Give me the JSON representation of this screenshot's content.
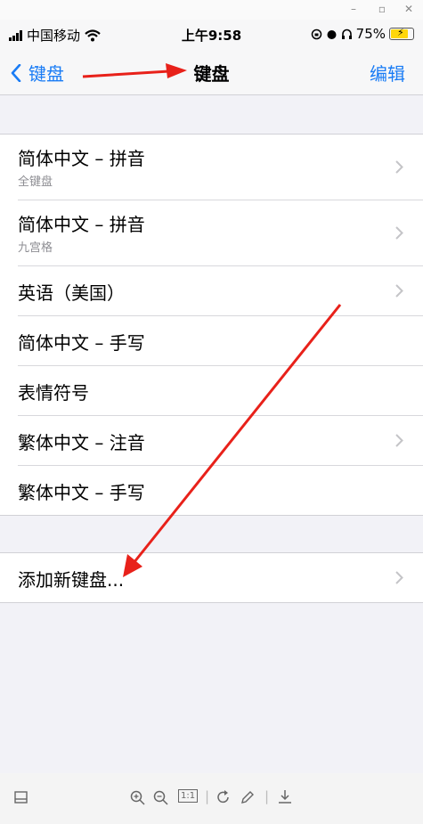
{
  "status_bar": {
    "carrier": "中国移动",
    "time": "上午9:58",
    "battery": "75%"
  },
  "nav": {
    "back_label": "键盘",
    "title": "键盘",
    "edit_label": "编辑"
  },
  "keyboards": [
    {
      "title": "简体中文 – 拼音",
      "subtitle": "全键盘",
      "chevron": true
    },
    {
      "title": "简体中文 – 拼音",
      "subtitle": "九宫格",
      "chevron": true
    },
    {
      "title": "英语（美国）",
      "subtitle": "",
      "chevron": true
    },
    {
      "title": "简体中文 – 手写",
      "subtitle": "",
      "chevron": false
    },
    {
      "title": "表情符号",
      "subtitle": "",
      "chevron": false
    },
    {
      "title": "繁体中文 – 注音",
      "subtitle": "",
      "chevron": true
    },
    {
      "title": "繁体中文 – 手写",
      "subtitle": "",
      "chevron": false
    }
  ],
  "add_keyboard": {
    "label": "添加新键盘..."
  },
  "toolbar": {
    "zoom_reset": "1:1"
  },
  "colors": {
    "accent": "#1a7cf5",
    "arrow": "#e8211a"
  },
  "icons": [
    "signal-icon",
    "wifi-icon",
    "alarm-icon",
    "headphones-icon",
    "battery-icon",
    "chevron-left-icon",
    "chevron-right-icon",
    "zoom-in-icon",
    "zoom-out-icon",
    "rotate-icon",
    "pencil-icon",
    "download-icon",
    "panel-icon"
  ]
}
